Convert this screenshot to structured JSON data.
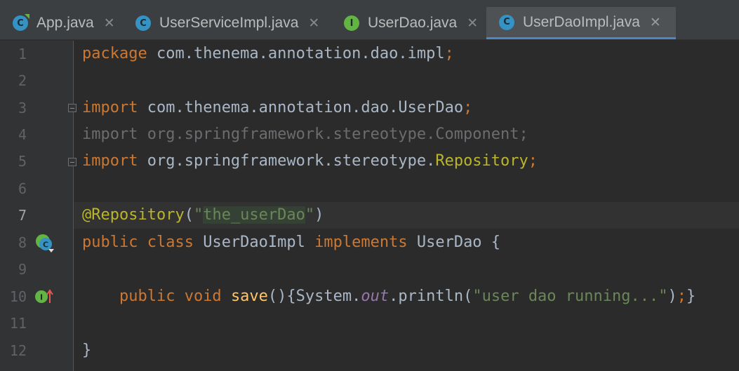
{
  "tabs": [
    {
      "label": "App.java",
      "icon": "java-main-class-icon",
      "letter": "C",
      "kind": "c",
      "active": false
    },
    {
      "label": "UserServiceImpl.java",
      "icon": "java-class-icon",
      "letter": "C",
      "kind": "c",
      "active": false
    },
    {
      "label": "UserDao.java",
      "icon": "java-interface-icon",
      "letter": "I",
      "kind": "i",
      "active": false
    },
    {
      "label": "UserDaoImpl.java",
      "icon": "java-class-icon",
      "letter": "C",
      "kind": "c",
      "active": true
    }
  ],
  "close_glyph": "✕",
  "colors": {
    "background": "#2b2b2b",
    "keyword": "#cc7832",
    "string": "#6a8759",
    "annotation": "#bbb529",
    "method": "#ffc66d",
    "static_field": "#9876aa",
    "text": "#a9b7c6",
    "tab_accent": "#4a88c7"
  },
  "editor": {
    "current_line": 7,
    "lines": [
      {
        "n": "1",
        "tokens": [
          [
            "kw",
            "package"
          ],
          [
            "t",
            " com.thenema.annotation.dao.impl"
          ],
          [
            "semi",
            ";"
          ]
        ]
      },
      {
        "n": "2",
        "tokens": []
      },
      {
        "n": "3",
        "tokens": [
          [
            "kw",
            "import"
          ],
          [
            "t",
            " com.thenema.annotation.dao.UserDao"
          ],
          [
            "semi",
            ";"
          ]
        ]
      },
      {
        "n": "4",
        "tokens": [
          [
            "dim",
            "import org.springframework.stereotype.Component;"
          ]
        ]
      },
      {
        "n": "5",
        "tokens": [
          [
            "kw",
            "import"
          ],
          [
            "t",
            " org.springframework.stereotype."
          ],
          [
            "repo",
            "Repository"
          ],
          [
            "semi",
            ";"
          ]
        ]
      },
      {
        "n": "6",
        "tokens": []
      },
      {
        "n": "7",
        "tokens": [
          [
            "ann",
            "@Repository"
          ],
          [
            "t",
            "("
          ],
          [
            "str",
            "\""
          ],
          [
            "strhl",
            "the_userDao"
          ],
          [
            "str",
            "\""
          ],
          [
            "t",
            ")"
          ]
        ]
      },
      {
        "n": "8",
        "tokens": [
          [
            "kw",
            "public class"
          ],
          [
            "t",
            " UserDaoImpl "
          ],
          [
            "kw",
            "implements"
          ],
          [
            "t",
            " UserDao {"
          ]
        ]
      },
      {
        "n": "9",
        "tokens": []
      },
      {
        "n": "10",
        "tokens": [
          [
            "t",
            "    "
          ],
          [
            "kw",
            "public void"
          ],
          [
            "t",
            " "
          ],
          [
            "fn",
            "save"
          ],
          [
            "t",
            "(){System."
          ],
          [
            "sf",
            "out"
          ],
          [
            "t",
            ".println("
          ],
          [
            "str",
            "\"user dao running...\""
          ],
          [
            "t",
            ")"
          ],
          [
            "semi",
            ";"
          ],
          [
            "t",
            "}"
          ]
        ]
      },
      {
        "n": "11",
        "tokens": []
      },
      {
        "n": "12",
        "tokens": [
          [
            "t",
            "}"
          ]
        ]
      }
    ]
  }
}
